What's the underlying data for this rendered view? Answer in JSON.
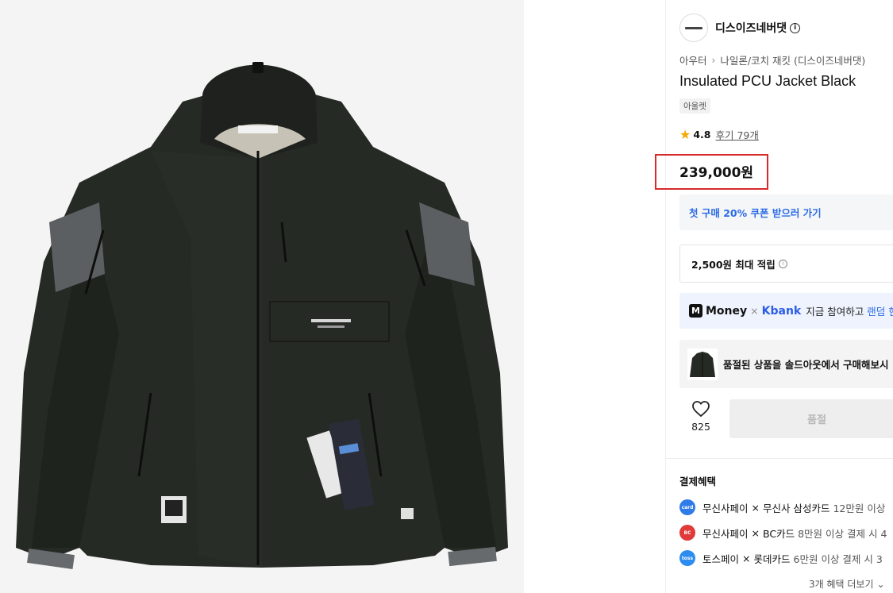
{
  "brand": {
    "name": "디스이즈네버댓"
  },
  "breadcrumb": {
    "category": "아우터",
    "subcategory": "나일론/코치 재킷 (디스이즈네버댓)"
  },
  "product": {
    "title": "Insulated PCU Jacket Black",
    "tag": "아울렛",
    "rating": "4.8",
    "reviews": "후기 79개",
    "price": "239,000원"
  },
  "coupon": {
    "label": "첫 구매 20% 쿠폰 받으러 가기"
  },
  "points": {
    "label": "2,500원 최대 적립"
  },
  "promo": {
    "money": "Money",
    "times": "×",
    "kbank": "Kbank",
    "text": "지금 참여하고",
    "highlight": "랜덤 현"
  },
  "soldout": {
    "label": "품절된 상품을 솔드아웃에서 구매해보시"
  },
  "like": {
    "count": "825"
  },
  "buy": {
    "label": "품절"
  },
  "benefits": {
    "title": "결제혜택",
    "items": [
      {
        "pay": "무신사페이",
        "card": "무신사 삼성카드",
        "rest": "12만원 이상",
        "color": "#2f7be8",
        "icon": "musinsa-samsung-card-icon"
      },
      {
        "pay": "무신사페이",
        "card": "BC카드",
        "rest": "8만원 이상 결제 시 4",
        "color": "#e03a3a",
        "icon": "bc-card-icon"
      },
      {
        "pay": "토스페이",
        "card": "롯데카드",
        "rest": "6만원 이상 결제 시 3",
        "color": "#2d8cf0",
        "icon": "toss-pay-icon"
      }
    ],
    "more": "3개 혜택 더보기"
  },
  "colors": {
    "price_highlight": "#d92a2a",
    "accent_blue": "#2b6be6",
    "jacket": "#222621"
  }
}
